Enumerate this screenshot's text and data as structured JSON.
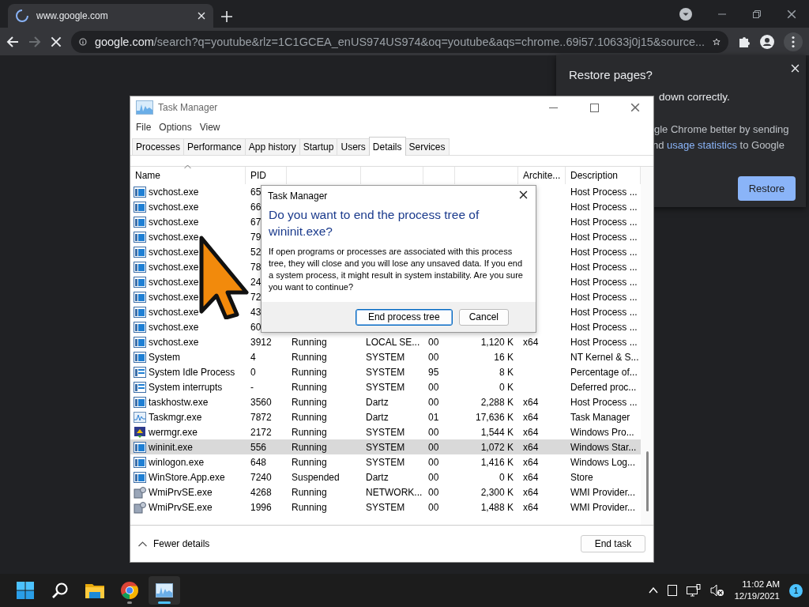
{
  "browser": {
    "tab": {
      "title": "www.google.com",
      "loading": true
    },
    "forward_disabled": true,
    "loading": true,
    "address": {
      "host": "google.com",
      "path": "/search?q=youtube&rlz=1C1GCEA_enUS974US974&oq=youtube&aqs=chrome..69i57.10633j0j15&source..."
    }
  },
  "restore_popup": {
    "title": "Restore pages?",
    "message_fragment": "down correctly.",
    "consent_line_1": "gle Chrome better by sending",
    "consent_line_2": {
      "before": "nd ",
      "link": "usage statistics",
      "after": " to Google"
    },
    "button": "Restore"
  },
  "task_manager": {
    "title": "Task Manager",
    "menu": [
      "File",
      "Options",
      "View"
    ],
    "tabs": [
      {
        "label": "Processes",
        "selected": false
      },
      {
        "label": "Performance",
        "selected": false
      },
      {
        "label": "App history",
        "selected": false
      },
      {
        "label": "Startup",
        "selected": false
      },
      {
        "label": "Users",
        "selected": false
      },
      {
        "label": "Details",
        "selected": true
      },
      {
        "label": "Services",
        "selected": false
      }
    ],
    "table": {
      "columns": [
        {
          "label": "Name",
          "sorted": true
        },
        {
          "label": "PID"
        },
        {},
        {},
        {},
        {},
        {
          "label": "Archite..."
        },
        {
          "label": "Description"
        }
      ],
      "rows": [
        {
          "kind": "app",
          "name": "svchost.exe",
          "pid": "65",
          "description": "Host Process ...",
          "selected": false
        },
        {
          "kind": "app",
          "name": "svchost.exe",
          "pid": "66",
          "description": "Host Process ...",
          "selected": false
        },
        {
          "kind": "app",
          "name": "svchost.exe",
          "pid": "67",
          "description": "Host Process ...",
          "selected": false
        },
        {
          "kind": "app",
          "name": "svchost.exe",
          "pid": "79",
          "description": "Host Process ...",
          "selected": false
        },
        {
          "kind": "app",
          "name": "svchost.exe",
          "pid": "52",
          "description": "Host Process ...",
          "selected": false
        },
        {
          "kind": "app",
          "name": "svchost.exe",
          "pid": "78",
          "description": "Host Process ...",
          "selected": false
        },
        {
          "kind": "app",
          "name": "svchost.exe",
          "pid": "24",
          "description": "Host Process ...",
          "selected": false
        },
        {
          "kind": "app",
          "name": "svchost.exe",
          "pid": "72",
          "description": "Host Process ...",
          "selected": false
        },
        {
          "kind": "app",
          "name": "svchost.exe",
          "pid": "43",
          "description": "Host Process ...",
          "selected": false
        },
        {
          "kind": "app",
          "name": "svchost.exe",
          "pid": "60",
          "description": "Host Process ...",
          "selected": false
        },
        {
          "kind": "app",
          "name": "svchost.exe",
          "pid": "3912",
          "status": "Running",
          "user": "LOCAL SE...",
          "cpu": "00",
          "memory": "1,120 K",
          "arch": "x64",
          "description": "Host Process ...",
          "selected": false
        },
        {
          "kind": "app",
          "name": "System",
          "pid": "4",
          "status": "Running",
          "user": "SYSTEM",
          "cpu": "00",
          "memory": "16 K",
          "description": "NT Kernel & S...",
          "selected": false
        },
        {
          "kind": "system",
          "name": "System Idle Process",
          "pid": "0",
          "status": "Running",
          "user": "SYSTEM",
          "cpu": "95",
          "memory": "8 K",
          "description": "Percentage of...",
          "selected": false
        },
        {
          "kind": "system",
          "name": "System interrupts",
          "pid": "-",
          "status": "Running",
          "user": "SYSTEM",
          "cpu": "00",
          "memory": "0 K",
          "description": "Deferred proc...",
          "selected": false
        },
        {
          "kind": "app",
          "name": "taskhostw.exe",
          "pid": "3560",
          "status": "Running",
          "user": "Dartz",
          "cpu": "00",
          "memory": "2,288 K",
          "arch": "x64",
          "description": "Host Process ...",
          "selected": false
        },
        {
          "kind": "chart",
          "name": "Taskmgr.exe",
          "pid": "7872",
          "status": "Running",
          "user": "Dartz",
          "cpu": "01",
          "memory": "17,636 K",
          "arch": "x64",
          "description": "Task Manager",
          "selected": false
        },
        {
          "kind": "report",
          "name": "wermgr.exe",
          "pid": "2172",
          "status": "Running",
          "user": "SYSTEM",
          "cpu": "00",
          "memory": "1,544 K",
          "arch": "x64",
          "description": "Windows Pro...",
          "selected": false
        },
        {
          "kind": "app",
          "name": "wininit.exe",
          "pid": "556",
          "status": "Running",
          "user": "SYSTEM",
          "cpu": "00",
          "memory": "1,072 K",
          "arch": "x64",
          "description": "Windows Star...",
          "selected": true
        },
        {
          "kind": "app",
          "name": "winlogon.exe",
          "pid": "648",
          "status": "Running",
          "user": "SYSTEM",
          "cpu": "00",
          "memory": "1,416 K",
          "arch": "x64",
          "description": "Windows Log...",
          "selected": false
        },
        {
          "kind": "app",
          "name": "WinStore.App.exe",
          "pid": "7240",
          "status": "Suspended",
          "user": "Dartz",
          "cpu": "00",
          "memory": "0 K",
          "arch": "x64",
          "description": "Store",
          "selected": false
        },
        {
          "kind": "service",
          "name": "WmiPrvSE.exe",
          "pid": "4268",
          "status": "Running",
          "user": "NETWORK...",
          "cpu": "00",
          "memory": "2,300 K",
          "arch": "x64",
          "description": "WMI Provider...",
          "selected": false
        },
        {
          "kind": "service",
          "name": "WmiPrvSE.exe",
          "pid": "1996",
          "status": "Running",
          "user": "SYSTEM",
          "cpu": "00",
          "memory": "1,488 K",
          "arch": "x64",
          "description": "WMI Provider...",
          "selected": false
        }
      ]
    },
    "footer": {
      "toggle": "Fewer details",
      "button": "End task"
    }
  },
  "dialog": {
    "title": "Task Manager",
    "heading": "Do you want to end the process tree of wininit.exe?",
    "message": "If open programs or processes are associated with this process tree, they will close and you will lose any unsaved data. If you end a system process, it might result in system instability. Are you sure you want to continue?",
    "buttons": [
      {
        "label": "End process tree",
        "default": true
      },
      {
        "label": "Cancel",
        "default": false
      }
    ]
  },
  "taskbar": {
    "apps": [
      {
        "kind": "start",
        "active": false,
        "running": false
      },
      {
        "kind": "search",
        "active": false,
        "running": false
      },
      {
        "kind": "folder",
        "active": false,
        "running": false
      },
      {
        "kind": "chrome",
        "active": false,
        "running": true
      },
      {
        "kind": "task-manager",
        "active": true,
        "running": true
      }
    ],
    "time": "11:02 AM",
    "date": "12/19/2021",
    "notifications": "1"
  }
}
